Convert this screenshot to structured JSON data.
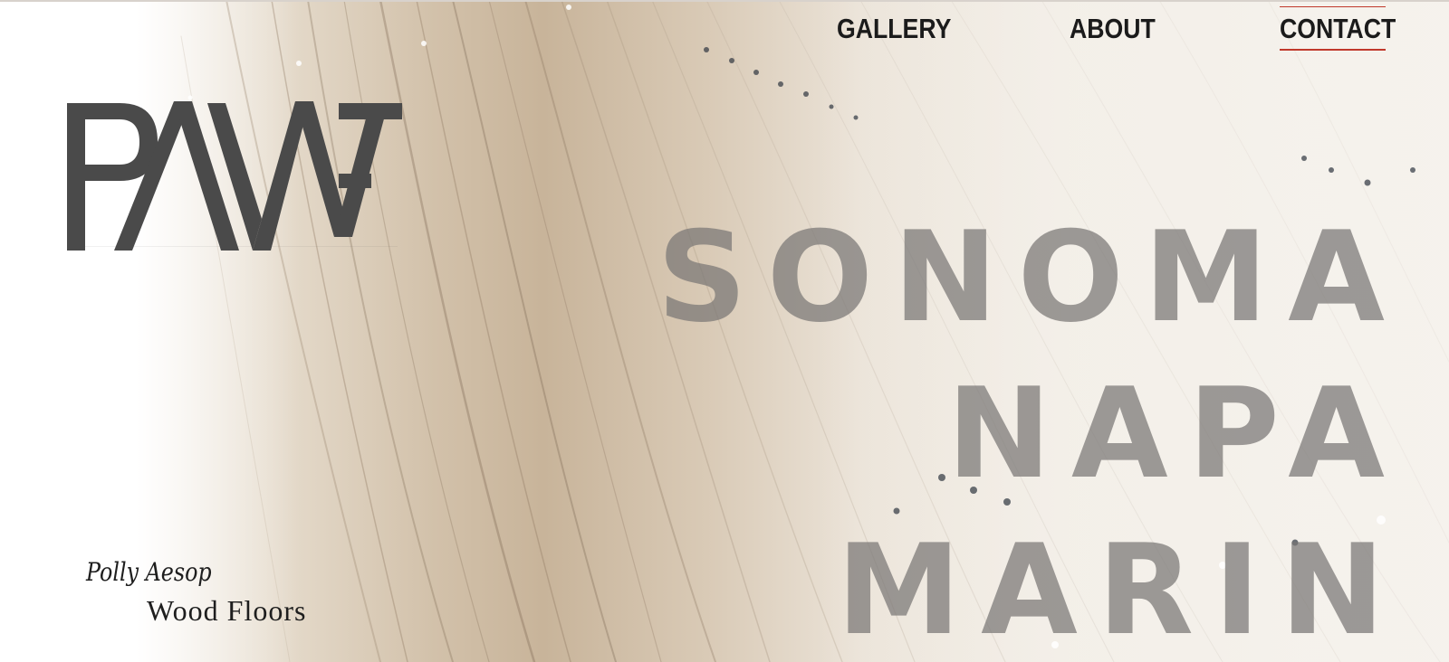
{
  "nav": {
    "items": [
      {
        "label": "GALLERY"
      },
      {
        "label": "ABOUT"
      },
      {
        "label": "CONTACT",
        "active": true
      }
    ],
    "active_color": "#c0392b"
  },
  "logo": {
    "text": "PAWF",
    "color": "#4a4a4a"
  },
  "hero": {
    "regions": [
      "SONOMA",
      "NAPA",
      "MARIN"
    ],
    "background": "wood-floor-photo"
  },
  "brand": {
    "line1": "Polly Aesop",
    "line2": "Wood Floors"
  }
}
